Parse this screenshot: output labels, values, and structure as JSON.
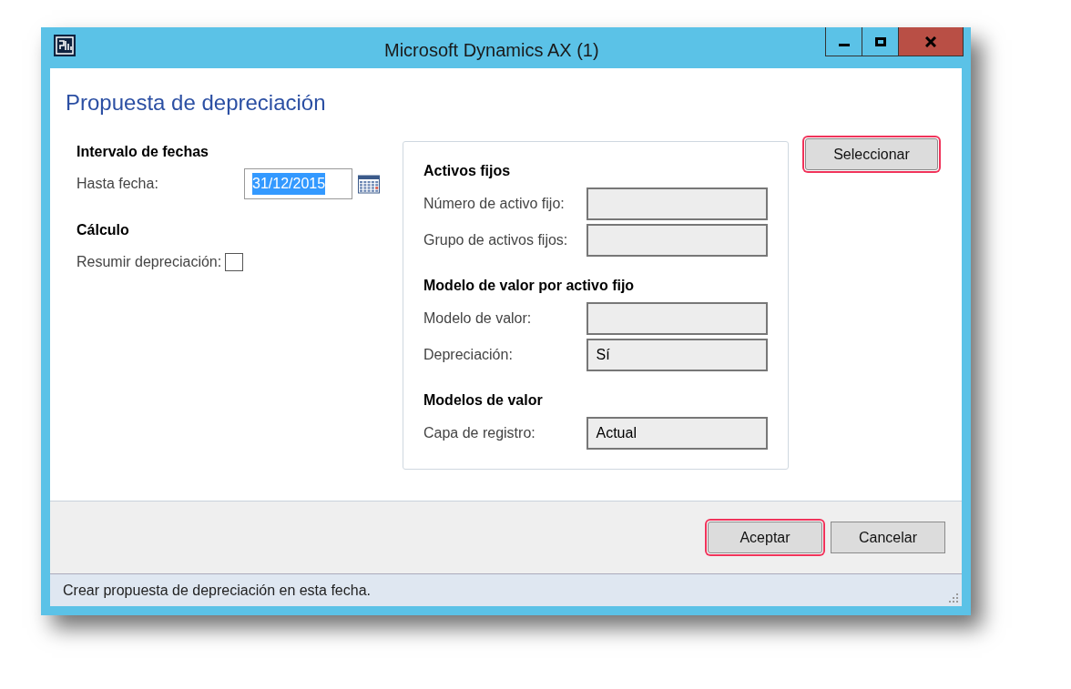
{
  "window": {
    "title": "Microsoft Dynamics AX (1)"
  },
  "form_title": "Propuesta de depreciación",
  "left_sections": [
    {
      "heading": "Intervalo de fechas",
      "fields": [
        {
          "kind": "date",
          "label": "Hasta fecha:",
          "value": "31/12/2015",
          "selected": true
        }
      ]
    },
    {
      "heading": "Cálculo",
      "fields": [
        {
          "kind": "checkbox",
          "label": "Resumir depreciación:",
          "checked": false
        }
      ]
    }
  ],
  "query_group": {
    "sections": [
      {
        "heading": "Activos fijos",
        "fields": [
          {
            "label": "Número de activo fijo:"
          },
          {
            "label": "Grupo de activos fijos:"
          }
        ]
      },
      {
        "heading": "Modelo de valor por activo fijo",
        "fields": [
          {
            "label": "Modelo de valor:"
          },
          {
            "label": "Depreciación:",
            "value": "Sí"
          }
        ]
      },
      {
        "heading": "Modelos de valor",
        "fields": [
          {
            "label": "Capa de registro:",
            "value": "Actual"
          }
        ]
      }
    ]
  },
  "select_button": {
    "label": "Seleccionar",
    "highlighted": true
  },
  "footer_buttons": [
    {
      "label": "Aceptar",
      "highlighted": true
    },
    {
      "label": "Cancelar",
      "highlighted": false
    }
  ],
  "status_bar": "Crear propuesta de depreciación en esta fecha."
}
